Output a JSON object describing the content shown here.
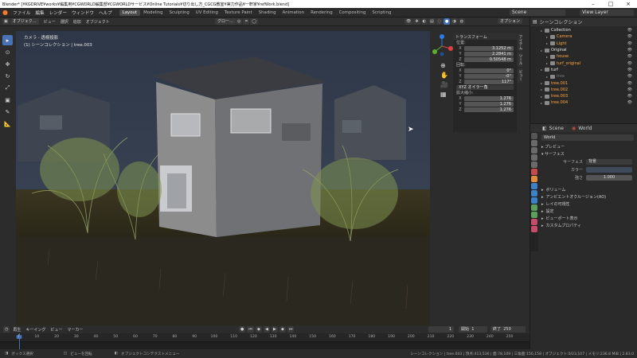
{
  "titlebar": {
    "text": "Blender* [¥KGDRIVE¥works¥編集用¥CGWORLD編集部¥CGWORLDサービス¥Online Tutorials¥切り出し方_CGCG教室¥実力作品¥一軒家¥refWork.blend]"
  },
  "menubar": {
    "menus": [
      "ファイル",
      "編集",
      "レンダー",
      "ウィンドウ",
      "ヘルプ"
    ],
    "workspaces": [
      "Layout",
      "Modeling",
      "Sculpting",
      "UV Editing",
      "Texture Paint",
      "Shading",
      "Animation",
      "Rendering",
      "Compositing",
      "Scripting"
    ],
    "active_workspace": "Layout",
    "scene": "Scene",
    "view_layer": "View Layer"
  },
  "viewport": {
    "header_mode": "オブジェク…",
    "header_menus": [
      "ビュー",
      "選択",
      "追加",
      "オブジェクト"
    ],
    "orientation": "グロー…",
    "options": "オプション",
    "camera_label": "カメラ - 透視投影",
    "collection_label": "(1) シーンコレクション | tree.003"
  },
  "npanel": {
    "title": "トランスフォーム",
    "location_label": "位置:",
    "location": [
      {
        "axis": "X",
        "value": "3.1252 m"
      },
      {
        "axis": "Y",
        "value": "2.2841 m"
      },
      {
        "axis": "Z",
        "value": "0.50548 m"
      }
    ],
    "rotation_label": "回転:",
    "rotation": [
      {
        "axis": "X",
        "value": "0°"
      },
      {
        "axis": "Y",
        "value": "-0°"
      },
      {
        "axis": "Z",
        "value": "117°"
      }
    ],
    "rotation_mode": "XYZ オイラー角",
    "scale_label": "拡大縮小:",
    "scale": [
      {
        "axis": "X",
        "value": "1.276"
      },
      {
        "axis": "Y",
        "value": "1.276"
      },
      {
        "axis": "Z",
        "value": "1.276"
      }
    ],
    "tabs": [
      "アイテム",
      "ツール",
      "ビュー"
    ]
  },
  "outliner": {
    "title": "シーンコレクション",
    "items": [
      {
        "name": "Collection",
        "indent": 1,
        "color": "#e6e6e6"
      },
      {
        "name": "Camera",
        "indent": 2,
        "color": "#ffa640"
      },
      {
        "name": "Light",
        "indent": 2,
        "color": "#ffa640"
      },
      {
        "name": "Original",
        "indent": 1,
        "color": "#e6e6e6"
      },
      {
        "name": "house",
        "indent": 2,
        "color": "#ffa640"
      },
      {
        "name": "turf_original",
        "indent": 2,
        "color": "#ffa640"
      },
      {
        "name": "turf",
        "indent": 1,
        "color": "#e6e6e6"
      },
      {
        "name": "tree",
        "indent": 2,
        "color": "#777777"
      },
      {
        "name": "tree.001",
        "indent": 1,
        "color": "#ffa640"
      },
      {
        "name": "tree.002",
        "indent": 1,
        "color": "#ffa640"
      },
      {
        "name": "tree.003",
        "indent": 1,
        "color": "#ffa640"
      },
      {
        "name": "tree.004",
        "indent": 1,
        "color": "#ffa640"
      }
    ]
  },
  "properties": {
    "scene": "Scene",
    "world_tab": "World",
    "world_name": "World",
    "sections": [
      "プレビュー",
      "サーフェス"
    ],
    "surface_label": "サーフェス",
    "surface_value": "背景",
    "color_label": "カラー",
    "strength_label": "強さ",
    "strength_value": "1.000",
    "bottom_sections": [
      "ボリューム",
      "アンビエントオクルージョン(AO)",
      "レイの可視性",
      "設定",
      "ビューポート表示",
      "カスタムプロパティ"
    ]
  },
  "timeline": {
    "menus": [
      "再生",
      "キーイング",
      "ビュー",
      "マーカー"
    ],
    "current_frame": "1",
    "start_label": "開始",
    "start": "1",
    "end_label": "終了",
    "end": "250",
    "ticks": [
      "1",
      "10",
      "20",
      "30",
      "40",
      "50",
      "60",
      "70",
      "80",
      "90",
      "100",
      "110",
      "120",
      "130",
      "140",
      "150",
      "160",
      "170",
      "180",
      "190",
      "200",
      "210",
      "220",
      "230",
      "240",
      "250"
    ]
  },
  "statusbar": {
    "left": "ボックス選択",
    "middle": "ビューを回転",
    "right_menu": "オブジェクトコンテクストメニュー",
    "stats": "シーンコレクション | tree.003 | 頂点:413,536 | 面:78,109 | 三角面:156,158 | オブジェクト:0/23,107 | メモリ:236.8 MiB | 2.83.0"
  },
  "colors": {
    "accent": "#4772b3",
    "selected": "#ffa640"
  }
}
